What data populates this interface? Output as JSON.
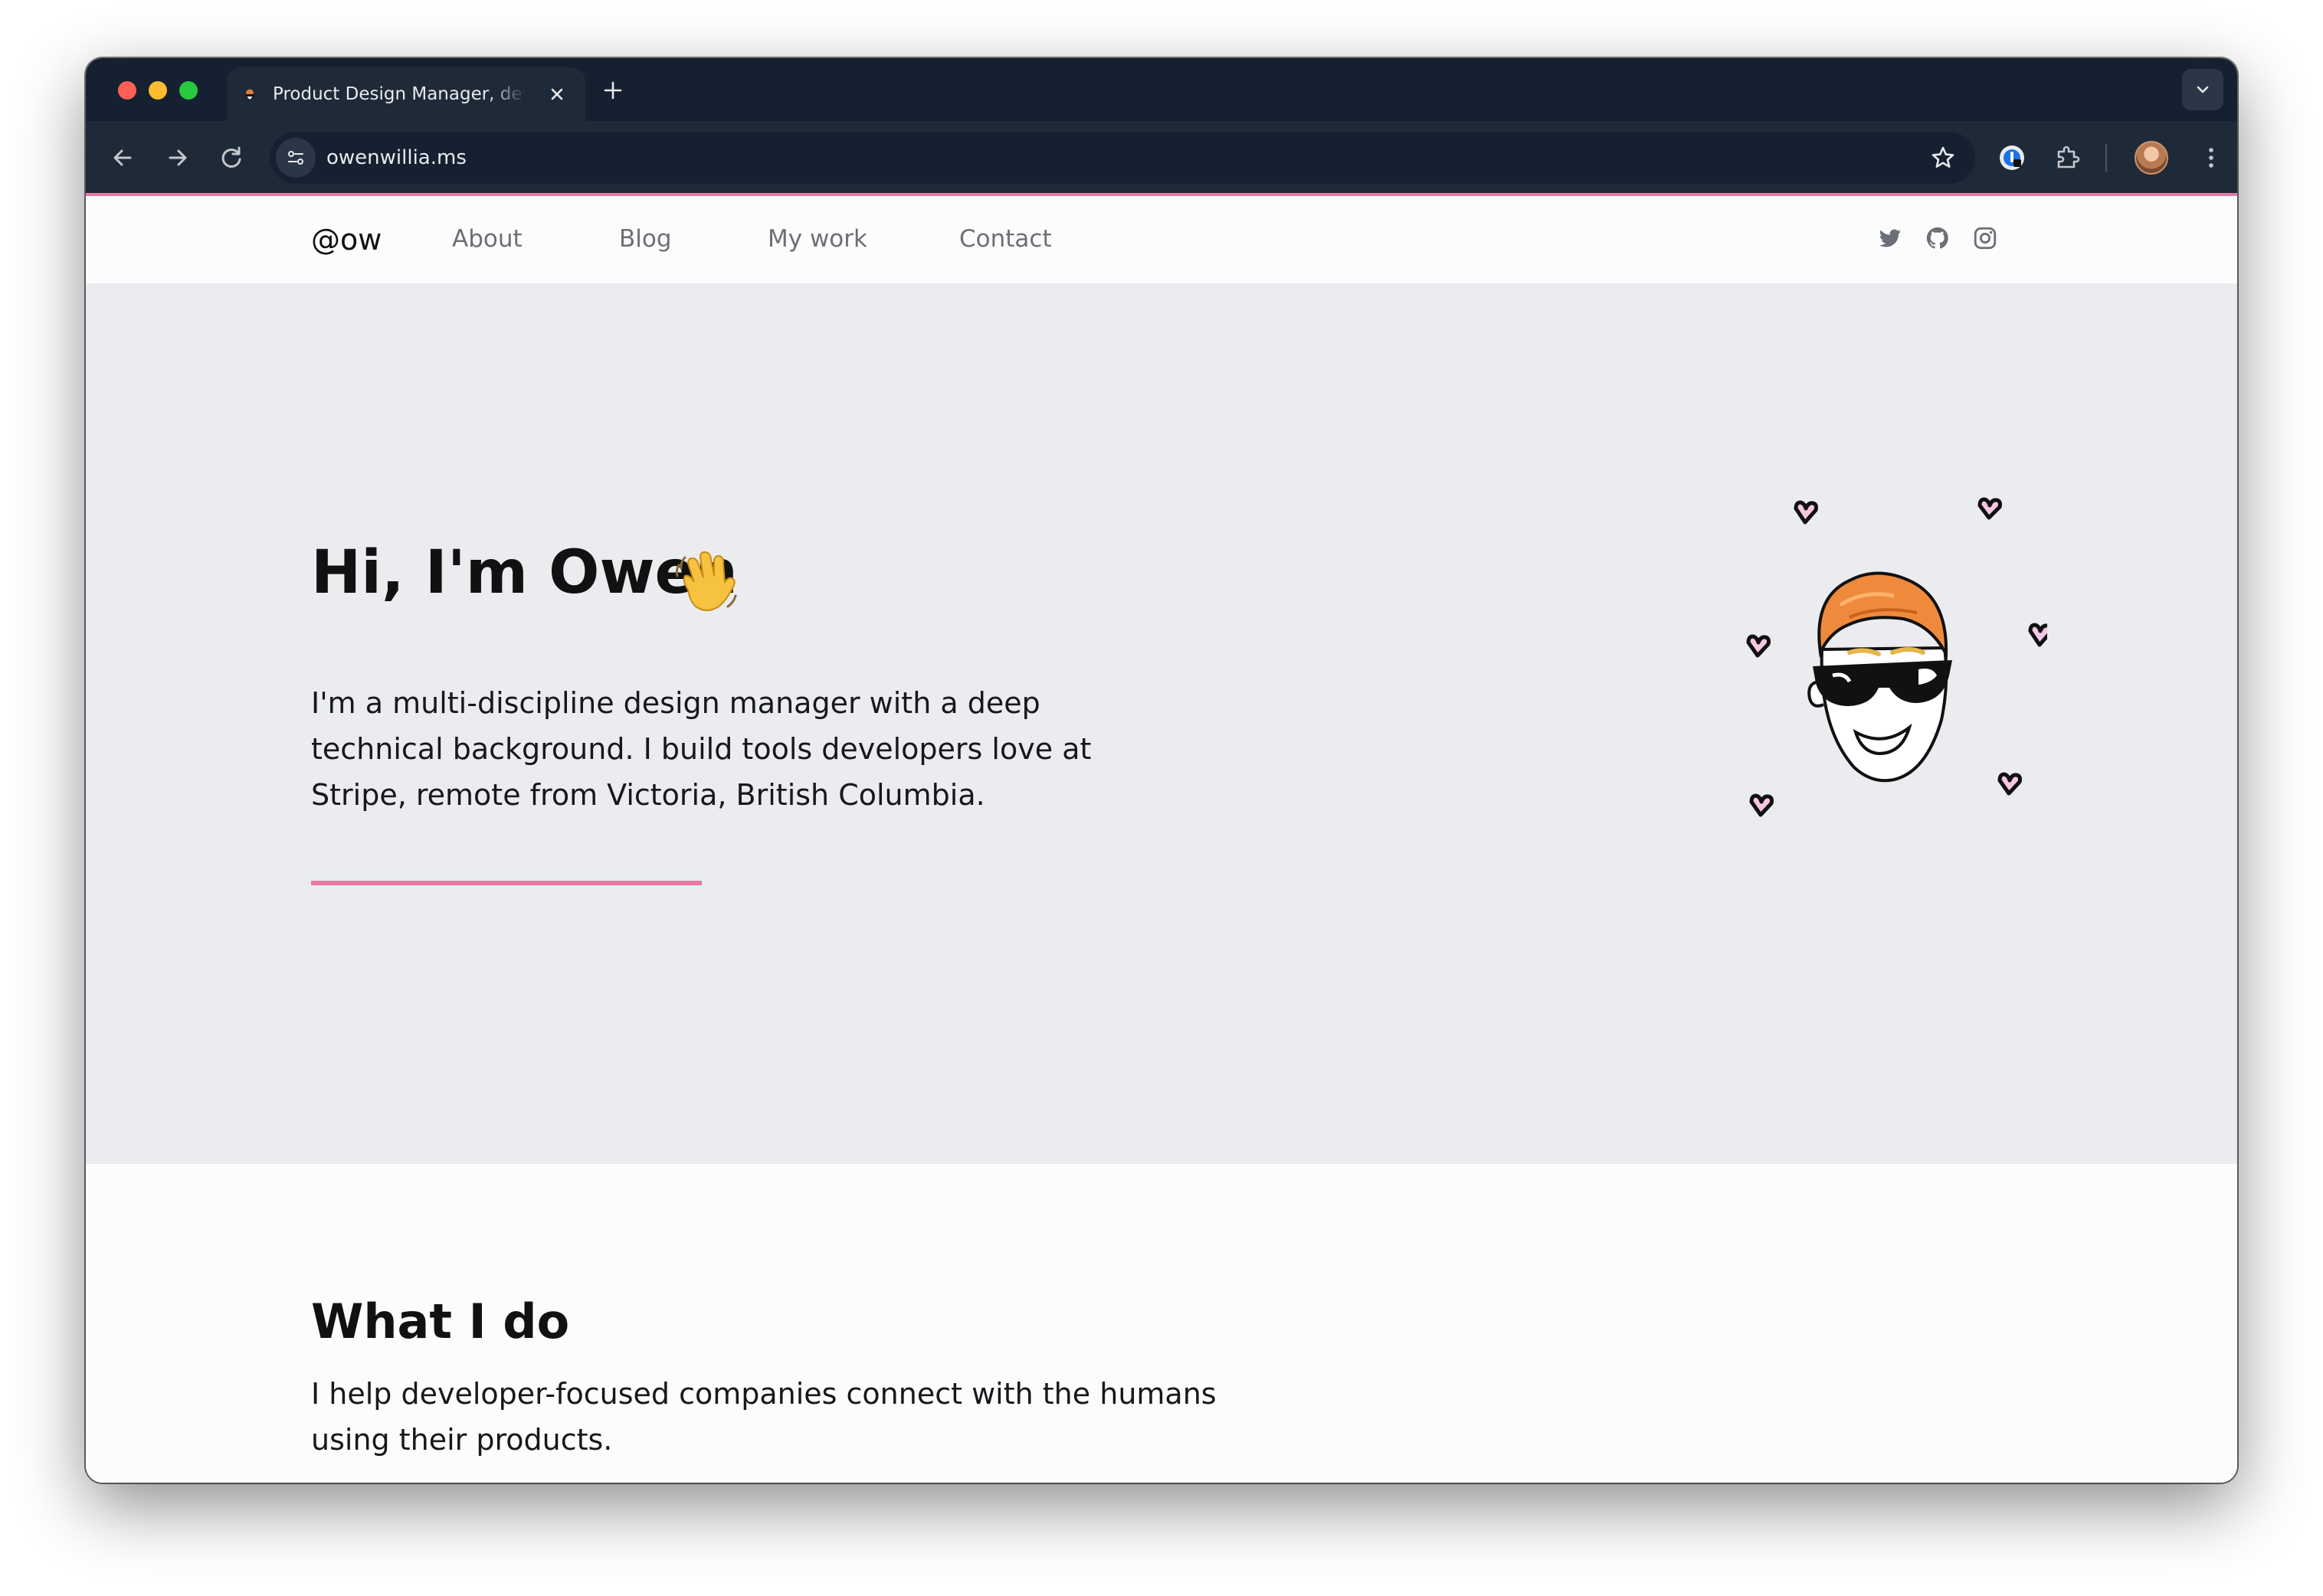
{
  "browser": {
    "tab": {
      "title": "Product Design Manager, developer"
    },
    "address_bar": {
      "url": "owenwillia.ms"
    },
    "icons": {
      "close": "close-icon",
      "new_tab": "plus-icon",
      "back": "arrow-left-icon",
      "forward": "arrow-right-icon",
      "reload": "reload-icon",
      "bookmark": "star-icon",
      "extensions": "puzzle-icon",
      "menu": "kebab-menu-icon"
    },
    "accent_color": "#e879a6"
  },
  "site": {
    "nav": {
      "brand": "@ow",
      "links": [
        "About",
        "Blog",
        "My work",
        "Contact"
      ],
      "social": [
        "twitter-icon",
        "github-icon",
        "instagram-icon"
      ]
    },
    "hero": {
      "title": "Hi, I'm Owen",
      "emoji": "👋",
      "text": "I'm a multi-discipline design manager with a deep technical background. I build tools developers love at Stripe, remote from Victoria, British Columbia."
    },
    "what_i_do": {
      "title": "What I do",
      "text": "I help developer-focused companies connect with the humans using their products."
    }
  }
}
